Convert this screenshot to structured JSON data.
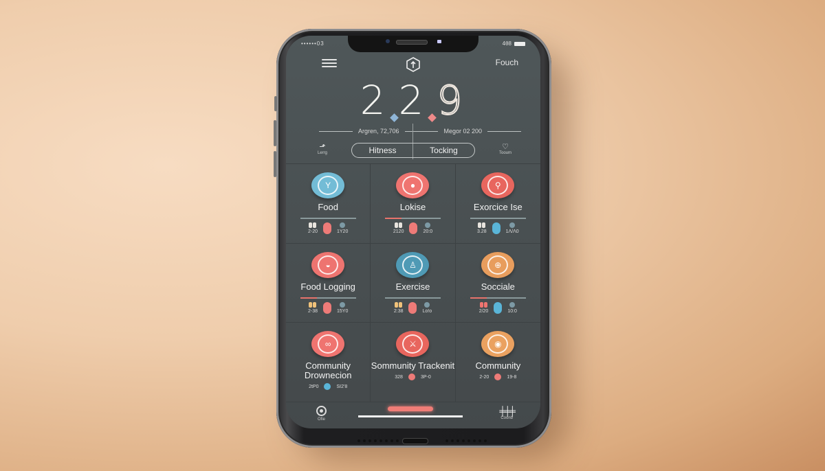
{
  "status_bar": {
    "carrier": "••••••03",
    "right_text": "4θ8"
  },
  "header": {
    "top_right_label": "Fouch",
    "logo_icon": "hexagon-up-icon",
    "menu_icon": "hamburger-menu-icon"
  },
  "big_number": {
    "d1": "2",
    "d2": "2",
    "d3": "9",
    "prefix": "9"
  },
  "stats": {
    "left": "Argren, 72,706",
    "right": "Megor 02 200"
  },
  "tabs": [
    {
      "label": "Hitness"
    },
    {
      "label": "Tocking"
    }
  ],
  "side_left": {
    "label": "Lerrg",
    "icon": "shoe-icon"
  },
  "side_right": {
    "label": "Tooum",
    "icon": "pin-icon"
  },
  "colors": {
    "accent_red": "#f07d77",
    "accent_blue": "#6cb6d3",
    "accent_orange": "#eaa160",
    "screen_bg": "#4a5153"
  },
  "tiles": [
    {
      "label": "Food",
      "icon": "fork-icon",
      "glyph": "Y",
      "color": "#73bcd6",
      "left": "2-20",
      "right": "1Y20",
      "bar_fill": 0,
      "pill_color": "#ee7b78"
    },
    {
      "label": "Lokise",
      "icon": "user-icon",
      "glyph": "●",
      "color": "#ef7470",
      "left": "2120",
      "right": "20:0",
      "bar_fill": 0.3,
      "pill_color": "#ee7b78"
    },
    {
      "label": "Exorcice Ise",
      "icon": "bicycle-icon",
      "glyph": "⚲",
      "color": "#e8665e",
      "left": "3.28",
      "right": "1Λ/Λ0",
      "bar_fill": 0,
      "pill_color": "#5ab5d8"
    },
    {
      "label": "Food Logging",
      "icon": "bowl-icon",
      "glyph": "◒",
      "color": "#ee7470",
      "left": "2-38",
      "right": "15Y0",
      "bar_fill": 0.3,
      "pill_color": "#ee7b78"
    },
    {
      "label": "Exercise",
      "icon": "person-icon",
      "glyph": "♙",
      "color": "#4f9ab5",
      "left": "2:38",
      "right": "Lo!o",
      "bar_fill": 0,
      "pill_color": "#ee7b78"
    },
    {
      "label": "Socciale",
      "icon": "globe-icon",
      "glyph": "⊕",
      "color": "#e89d5d",
      "left": "2/20",
      "right": "10:0",
      "bar_fill": 0.3,
      "pill_color": "#5ab5d8"
    },
    {
      "label": "Community Drownecion",
      "icon": "infinity-icon",
      "glyph": "∞",
      "color": "#ef7470",
      "left": "2tP0",
      "right": "SI2'8",
      "dot_color": "#5ab5d8"
    },
    {
      "label": "Sommunity Trackenit",
      "icon": "runner-icon",
      "glyph": "⚔",
      "color": "#e8665e",
      "left": "328",
      "right": "3P-0",
      "dot_color": "#ee7b78"
    },
    {
      "label": "Community",
      "icon": "profile-icon",
      "glyph": "◉",
      "color": "#eaa160",
      "left": "2-20",
      "right": "19-8",
      "dot_color": "#ee7b78"
    }
  ],
  "bottom_nav": {
    "left_label": "Ofie",
    "left_icon": "target-icon",
    "right_label": "Coonb",
    "right_icon": "bars-icon"
  }
}
